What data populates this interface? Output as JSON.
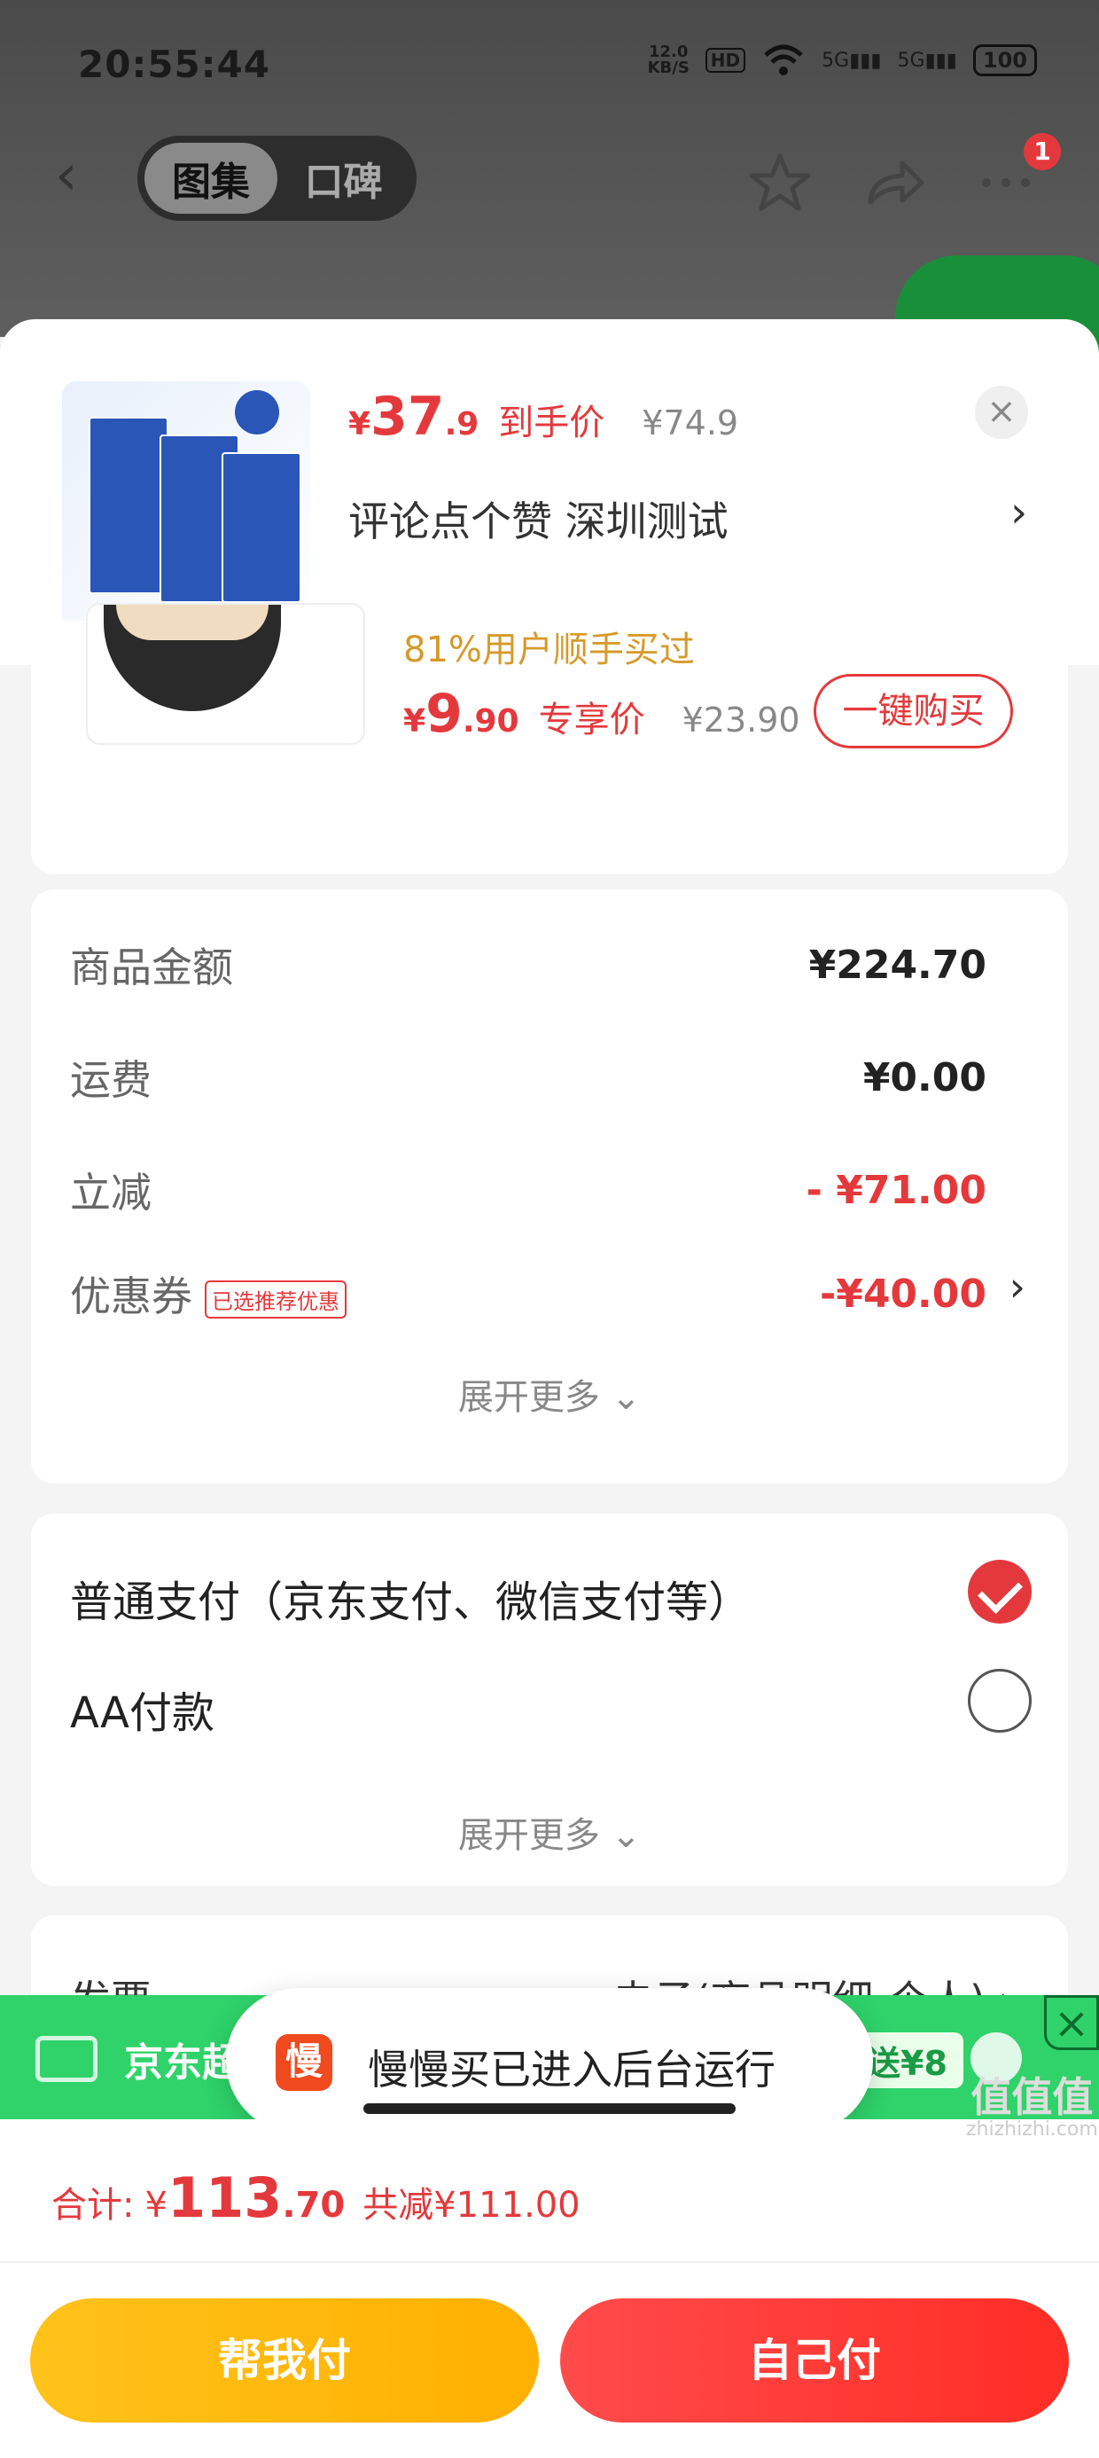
{
  "status_bar": {
    "time": "20:55:44",
    "net_speed": "12.0",
    "net_unit": "KB/S",
    "hd": "HD",
    "sig1": "5G",
    "sig2": "5G",
    "battery": "100"
  },
  "nav": {
    "tabs": [
      {
        "label": "图集",
        "active": true
      },
      {
        "label": "口碑",
        "active": false
      }
    ],
    "badge": "1",
    "icons": [
      "back-arrow-icon",
      "star-icon",
      "share-icon",
      "more-icon"
    ]
  },
  "product": {
    "price_yen": "¥",
    "price_int": "37",
    "price_dec": ".9",
    "price_label": "到手价",
    "orig_price": "¥74.9",
    "comment_text": "评论点个赞  深圳测试",
    "close_symbol": "×"
  },
  "bundle": {
    "subtitle": "81%用户顺手买过",
    "price_yen": "¥",
    "price_int": "9",
    "price_dec": ".90",
    "price_label": "专享价",
    "orig_price": "¥23.90",
    "buy_label": "一键购买"
  },
  "summary": {
    "rows": [
      {
        "key": "商品金额",
        "value": "¥224.70"
      },
      {
        "key": "运费",
        "value": "¥0.00"
      },
      {
        "key": "立减",
        "value": "- ¥71.00"
      },
      {
        "key": "优惠券",
        "value": "-¥40.00",
        "tag": "已选推荐优惠"
      }
    ],
    "expand": "展开更多 ⌄"
  },
  "payment": {
    "options": [
      {
        "label": "普通支付（京东支付、微信支付等）",
        "selected": true
      },
      {
        "label": "AA付款",
        "selected": false
      }
    ],
    "expand": "展开更多 ⌄"
  },
  "invoice": {
    "key": "发票",
    "value": "电子(商品明细-个人) ›"
  },
  "jd_bar": {
    "label": "京东超",
    "gift": "送¥8",
    "close": "×"
  },
  "toast": {
    "logo": "慢",
    "message": "慢慢买已进入后台运行"
  },
  "footer": {
    "total_label": "合计:",
    "total_yen": "¥",
    "total_int": "113",
    "total_dec": ".70",
    "total_cut": "共减¥111.00",
    "help_pay": "帮我付",
    "self_pay": "自己付"
  },
  "watermark": {
    "glyph": "值值值",
    "text": "zhizhizhi.com"
  },
  "colors": {
    "accent": "#e4393c",
    "green": "#2fd36a",
    "yellow": "#ffb000"
  }
}
